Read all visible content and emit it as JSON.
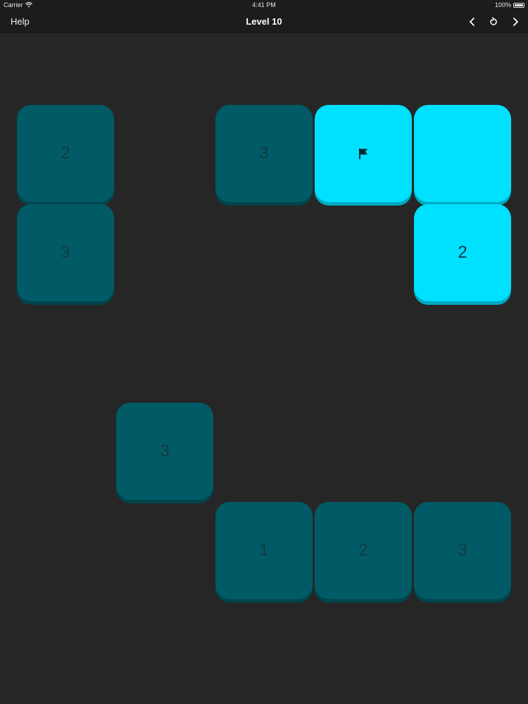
{
  "status_bar": {
    "carrier": "Carrier",
    "time": "4:41 PM",
    "battery": "100%"
  },
  "nav": {
    "help_label": "Help",
    "title": "Level 10",
    "back_icon": "chevron-left-icon",
    "restart_icon": "restart-icon",
    "forward_icon": "chevron-right-icon"
  },
  "colors": {
    "background": "#262626",
    "tile_dark": "#005b66",
    "tile_light": "#00e0ff"
  },
  "tiles": [
    {
      "label": "2",
      "state": "dark",
      "row": 1,
      "col": 0
    },
    {
      "label": "3",
      "state": "dark",
      "row": 1,
      "col": 2
    },
    {
      "label": "",
      "state": "light",
      "row": 1,
      "col": 3,
      "icon": "flag-icon"
    },
    {
      "label": "",
      "state": "light",
      "row": 1,
      "col": 4
    },
    {
      "label": "3",
      "state": "dark",
      "row": 2,
      "col": 0
    },
    {
      "label": "2",
      "state": "light",
      "row": 2,
      "col": 4
    },
    {
      "label": "3",
      "state": "dark",
      "row": 4,
      "col": 1
    },
    {
      "label": "1",
      "state": "dark",
      "row": 5,
      "col": 2
    },
    {
      "label": "2",
      "state": "dark",
      "row": 5,
      "col": 3
    },
    {
      "label": "3",
      "state": "dark",
      "row": 5,
      "col": 4
    }
  ]
}
